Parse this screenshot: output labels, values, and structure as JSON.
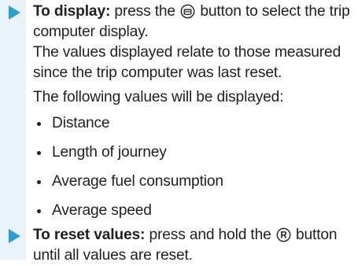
{
  "document": {
    "step_display": {
      "label": "To display:",
      "text_before_icon": " press the ",
      "icon": "trip-computer-button-icon",
      "text_after_icon": " button to select the trip computer display.",
      "info_line": "The values displayed relate to those measured since the trip computer was last reset.",
      "intro": "The following values will be displayed:",
      "bullets": [
        "Distance",
        "Length of journey",
        "Average fuel consumption",
        "Average speed"
      ]
    },
    "step_reset": {
      "label": "To reset values:",
      "text_before_icon": " press and hold the ",
      "icon": "r-button-icon",
      "icon_letter": "R",
      "text_after_icon": " button until all values are reset."
    }
  },
  "colors": {
    "band": "#e7f3f8",
    "arrow": "#2a9fd0",
    "text": "#1f1f1f"
  }
}
